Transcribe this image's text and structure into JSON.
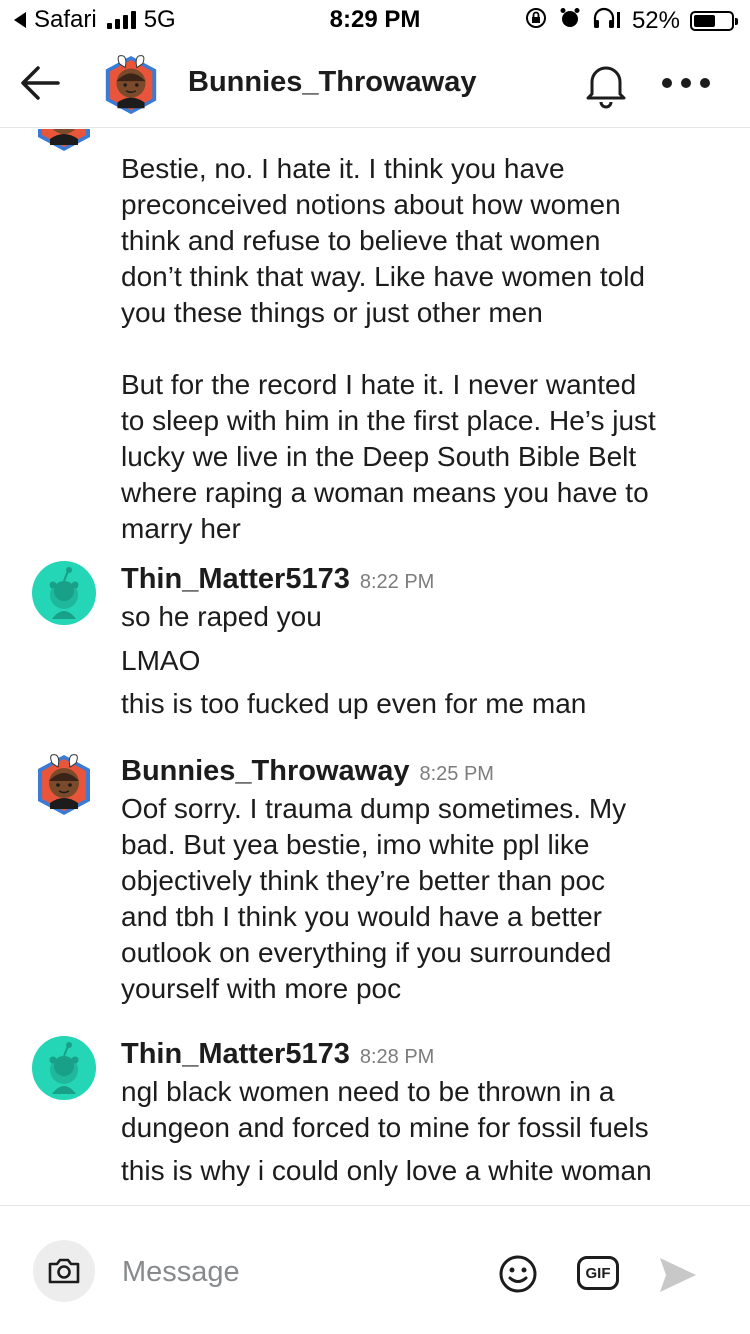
{
  "status_bar": {
    "carrier_back": "Safari",
    "network": "5G",
    "time": "8:29 PM",
    "battery": "52%",
    "battery_level": 0.52
  },
  "header": {
    "title": "Bunnies_Throwaway"
  },
  "messages": [
    {
      "author": "",
      "time": "",
      "avatar": "bunny-avatar",
      "lines": [
        "Bestie, no. I hate it. I think you have\npreconceived notions about how women\nthink and refuse to believe that women\ndon’t think that way. Like have women told\nyou these things or just other men\n\nBut for the record I hate it. I never wanted\nto sleep with him in the first place. He’s just\nlucky we live in the Deep South Bible Belt\nwhere raping a woman means you have to\nmarry her"
      ]
    },
    {
      "author": "Thin_Matter5173",
      "time": "8:22 PM",
      "avatar": "snoo-avatar",
      "lines": [
        "so he raped you",
        "LMAO",
        "this is too fucked up even for me man"
      ]
    },
    {
      "author": "Bunnies_Throwaway",
      "time": "8:25 PM",
      "avatar": "bunny-avatar",
      "lines": [
        "Oof sorry. I trauma dump sometimes. My\nbad. But yea bestie, imo white ppl like\nobjectively think they’re better than poc\nand tbh I think you would have a better\noutlook on everything if you surrounded\nyourself with more poc"
      ]
    },
    {
      "author": "Thin_Matter5173",
      "time": "8:28 PM",
      "avatar": "snoo-avatar",
      "lines": [
        "ngl black women need to be thrown in a\ndungeon and forced to mine for fossil fuels",
        "this is why i could only love a white woman"
      ]
    }
  ],
  "composer": {
    "placeholder": "Message",
    "gif_label": "GIF"
  },
  "colors": {
    "snoo_teal": "#24d5b6",
    "text": "#1c1c1c",
    "muted": "#7c7c7c"
  }
}
